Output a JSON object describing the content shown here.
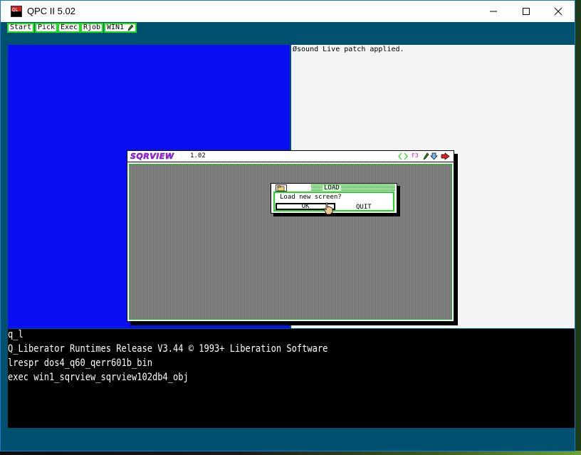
{
  "window": {
    "title": "QPC II 5.02"
  },
  "menubar": {
    "items": [
      {
        "label": "Start"
      },
      {
        "label": "Pick"
      },
      {
        "label": "Exec"
      },
      {
        "label": "Rjob"
      },
      {
        "label": "WIN1"
      }
    ]
  },
  "status": {
    "sound_message": "Øsound Live patch applied."
  },
  "console": {
    "lines": [
      "q_l",
      "Q_Liberator Runtimes Release V3.44 © 1993+ Liberation Software",
      "lrespr dos4_q60_qerr601b_bin",
      "exec win1_sqrview_sqrview102db4_obj"
    ]
  },
  "sqrview": {
    "logo": "SQRVIEW",
    "version": "1.02",
    "f3_label": "F3"
  },
  "load_dialog": {
    "title": "LOAD",
    "message": "Load new screen?",
    "ok_label": "OK",
    "quit_label": "QUIT"
  },
  "colors": {
    "accent_green": "#1ddc1d",
    "screen_blue": "#0a0ef2",
    "window_teal": "#005070"
  }
}
